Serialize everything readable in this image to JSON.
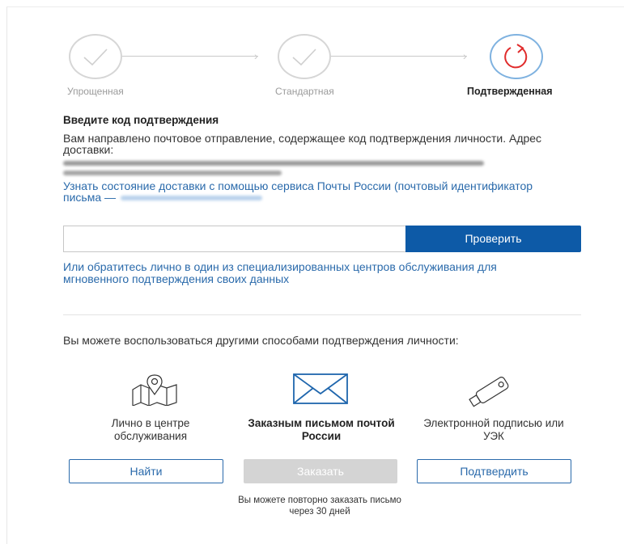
{
  "stepper": {
    "steps": [
      {
        "label": "Упрощенная",
        "state": "done"
      },
      {
        "label": "Стандартная",
        "state": "done"
      },
      {
        "label": "Подтвержденная",
        "state": "active"
      }
    ]
  },
  "confirm": {
    "title": "Введите код подтверждения",
    "description": "Вам направлено почтовое отправление, содержащее код подтверждения личности. Адрес доставки:",
    "track_link": "Узнать состояние доставки с помощью сервиса Почты России (почтовый идентификатор письма —",
    "input_placeholder": "",
    "check_button": "Проверить",
    "center_link": "Или обратитесь лично в один из специализированных центров обслуживания для мгновенного подтверждения своих данных"
  },
  "other": {
    "title": "Вы можете воспользоваться другими способами подтверждения личности:",
    "methods": [
      {
        "label": "Лично в центре обслуживания",
        "icon": "map-icon",
        "button": "Найти"
      },
      {
        "label": "Заказным письмом почтой России",
        "icon": "envelope-icon",
        "button": "Заказать"
      },
      {
        "label": "Электронной подписью или УЭК",
        "icon": "usb-key-icon",
        "button": "Подтвердить"
      }
    ],
    "reorder_note": "Вы можете повторно заказать письмо через 30 дней"
  },
  "colors": {
    "primary": "#0d5aa7",
    "link": "#2a6aab",
    "active_step_red": "#e02b2b",
    "disabled": "#d4d4d4"
  }
}
